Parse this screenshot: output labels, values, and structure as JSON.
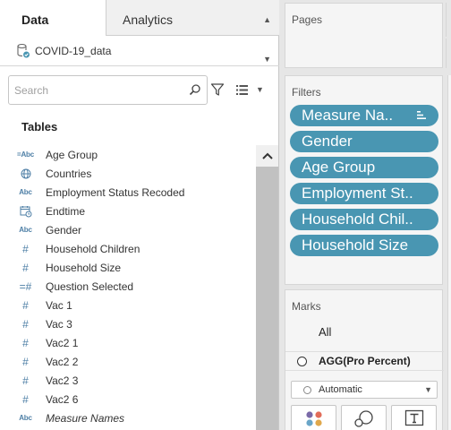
{
  "tabs": {
    "data_label": "Data",
    "analytics_label": "Analytics"
  },
  "datasource": {
    "name": "COVID-19_data",
    "icon": "database-check-icon"
  },
  "search": {
    "placeholder": "Search",
    "value": ""
  },
  "tables_header": "Tables",
  "fields": [
    {
      "label": "Age Group",
      "type": "calc-string",
      "icon_text": "Abc"
    },
    {
      "label": "Countries",
      "type": "geo",
      "icon_text": ""
    },
    {
      "label": "Employment Status Recoded",
      "type": "string",
      "icon_text": "Abc"
    },
    {
      "label": "Endtime",
      "type": "datetime",
      "icon_text": ""
    },
    {
      "label": "Gender",
      "type": "string",
      "icon_text": "Abc"
    },
    {
      "label": "Household Children",
      "type": "number",
      "icon_text": "#"
    },
    {
      "label": "Household Size",
      "type": "number",
      "icon_text": "#"
    },
    {
      "label": "Question Selected",
      "type": "calc-number",
      "icon_text": "=#"
    },
    {
      "label": "Vac 1",
      "type": "number",
      "icon_text": "#"
    },
    {
      "label": "Vac 3",
      "type": "number",
      "icon_text": "#"
    },
    {
      "label": "Vac2 1",
      "type": "number",
      "icon_text": "#"
    },
    {
      "label": "Vac2 2",
      "type": "number",
      "icon_text": "#"
    },
    {
      "label": "Vac2 3",
      "type": "number",
      "icon_text": "#"
    },
    {
      "label": "Vac2 6",
      "type": "number",
      "icon_text": "#"
    },
    {
      "label": "Measure Names",
      "type": "string-italic",
      "icon_text": "Abc"
    }
  ],
  "pages": {
    "title": "Pages"
  },
  "filters": {
    "title": "Filters",
    "pills": [
      {
        "label": "Measure Na..",
        "sorted": true
      },
      {
        "label": "Gender",
        "sorted": false
      },
      {
        "label": "Age Group",
        "sorted": false
      },
      {
        "label": "Employment St..",
        "sorted": false
      },
      {
        "label": "Household Chil..",
        "sorted": false
      },
      {
        "label": "Household Size",
        "sorted": false
      }
    ]
  },
  "marks": {
    "title": "Marks",
    "all_label": "All",
    "agg_label": "AGG(Pro Percent)",
    "mark_type": "Automatic",
    "buttons": [
      "color-icon",
      "size-icon",
      "label-icon"
    ]
  },
  "colors": {
    "pill": "#4996b2",
    "field_icon": "#4e7fa6"
  }
}
